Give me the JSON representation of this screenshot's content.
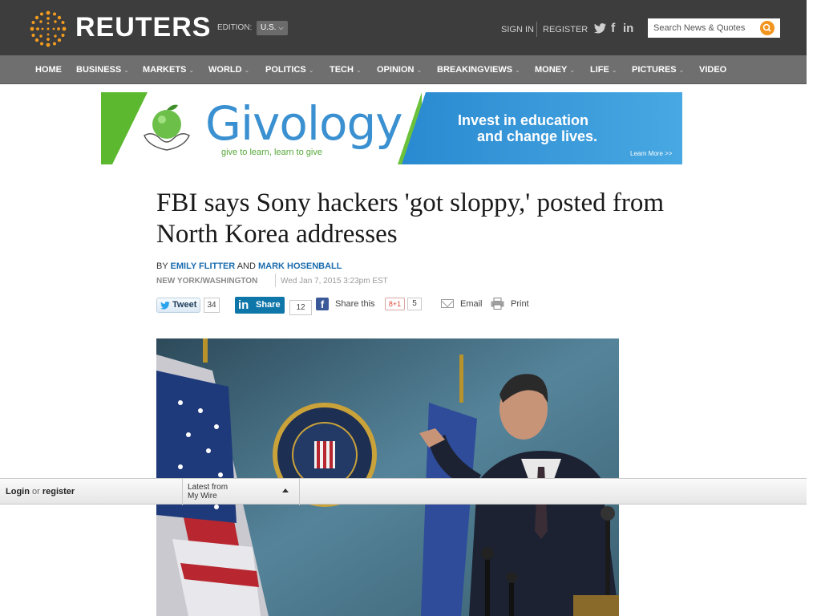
{
  "header": {
    "brand": "REUTERS",
    "edition_label": "EDITION:",
    "edition_value": "U.S.",
    "sign_in": "SIGN IN",
    "register": "REGISTER",
    "social_icons": [
      "twitter-icon",
      "facebook-icon",
      "linkedin-icon"
    ],
    "search_placeholder": "Search News & Quotes",
    "accent_color": "#f2951f"
  },
  "nav": {
    "items": [
      "HOME",
      "BUSINESS",
      "MARKETS",
      "WORLD",
      "POLITICS",
      "TECH",
      "OPINION",
      "BREAKINGVIEWS",
      "MONEY",
      "LIFE",
      "PICTURES",
      "VIDEO"
    ]
  },
  "banner": {
    "brand": "Givology",
    "tagline": "give to learn, learn to give",
    "pitch_line1": "Invest in education",
    "pitch_line2": "and change lives.",
    "cta": "Learn More >>"
  },
  "article": {
    "headline": "FBI says Sony hackers 'got sloppy,' posted from North Korea addresses",
    "by": "BY",
    "author1": "EMILY FLITTER",
    "and": "AND",
    "author2": "MARK HOSENBALL",
    "dateline": "NEW YORK/WASHINGTON",
    "timestamp": "Wed Jan 7, 2015 3:23pm EST"
  },
  "share": {
    "tweet_label": "Tweet",
    "tweet_count": "34",
    "linkedin_label": "Share",
    "linkedin_count": "12",
    "facebook_label": "Share this",
    "gplus_label": "8+1",
    "gplus_count": "5",
    "email_label": "Email",
    "print_label": "Print"
  },
  "bottom_bar": {
    "login": "Login",
    "or": "or",
    "register": "register",
    "latest_line1": "Latest from",
    "latest_line2": "My Wire"
  }
}
